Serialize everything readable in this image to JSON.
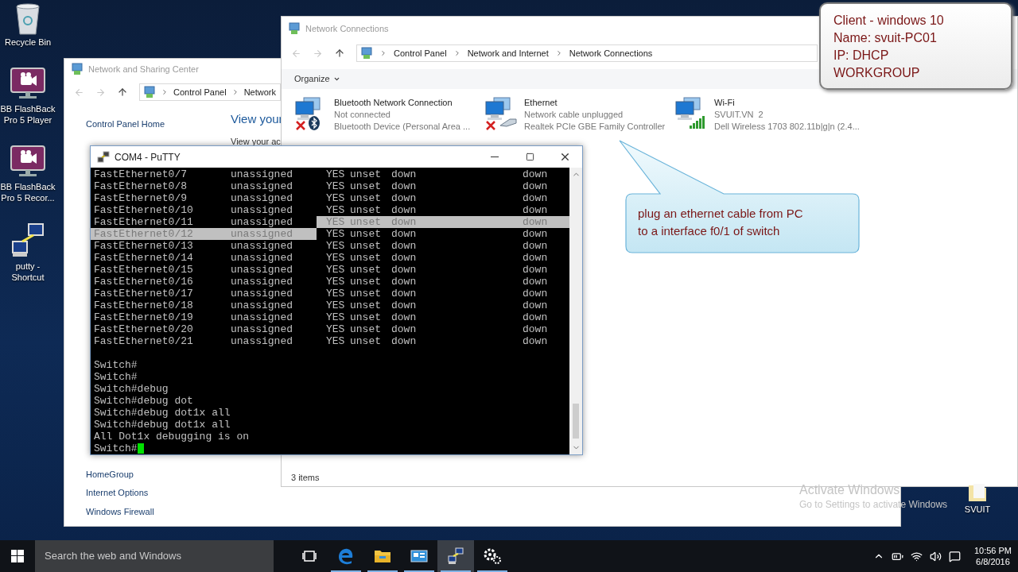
{
  "desktop_icons": [
    {
      "label": "Recycle Bin",
      "kind": "bin"
    },
    {
      "label": "BB FlashBack Pro 5 Player",
      "kind": "flashback"
    },
    {
      "label": "BB FlashBack Pro 5 Recor...",
      "kind": "flashback"
    },
    {
      "label": "putty - Shortcut",
      "kind": "putty"
    }
  ],
  "sharing_center": {
    "title": "Network and Sharing Center",
    "breadcrumb": [
      "Control Panel",
      "Network"
    ],
    "sidebar_link": "Control Panel Home",
    "heading": "View your",
    "subheading": "View your ac",
    "links": [
      "HomeGroup",
      "Internet Options",
      "Windows Firewall"
    ]
  },
  "connections_window": {
    "title": "Network Connections",
    "breadcrumb": [
      "Control Panel",
      "Network and Internet",
      "Network Connections"
    ],
    "toolbar": "Organize",
    "items": [
      {
        "name": "Bluetooth Network Connection",
        "status": "Not connected",
        "device": "Bluetooth Device (Personal Area ...",
        "kind": "bluetooth",
        "disconnected": true
      },
      {
        "name": "Ethernet",
        "status": "Network cable unplugged",
        "device": "Realtek PCIe GBE Family Controller",
        "kind": "ethernet",
        "disconnected": true
      },
      {
        "name": "Wi-Fi",
        "status": "SVUIT.VN  2",
        "device": "Dell Wireless 1703 802.11b|g|n (2.4...",
        "kind": "wifi",
        "disconnected": false
      }
    ],
    "status_bar": "3 items"
  },
  "info_box": [
    "Client - windows 10",
    "Name: svuit-PC01",
    "IP: DHCP",
    "WORKGROUP"
  ],
  "putty": {
    "title": "COM4 - PuTTY",
    "rows": [
      {
        "interface": "FastEthernet0/7",
        "ip": "unassigned",
        "ok": "YES",
        "method": "unset",
        "status": "down",
        "protocol": "down",
        "left_selected": false,
        "right_selected": false
      },
      {
        "interface": "FastEthernet0/8",
        "ip": "unassigned",
        "ok": "YES",
        "method": "unset",
        "status": "down",
        "protocol": "down",
        "left_selected": false,
        "right_selected": false
      },
      {
        "interface": "FastEthernet0/9",
        "ip": "unassigned",
        "ok": "YES",
        "method": "unset",
        "status": "down",
        "protocol": "down",
        "left_selected": false,
        "right_selected": false
      },
      {
        "interface": "FastEthernet0/10",
        "ip": "unassigned",
        "ok": "YES",
        "method": "unset",
        "status": "down",
        "protocol": "down",
        "left_selected": false,
        "right_selected": false
      },
      {
        "interface": "FastEthernet0/11",
        "ip": "unassigned",
        "ok": "YES",
        "method": "unset",
        "status": "down",
        "protocol": "down",
        "left_selected": false,
        "right_selected": true
      },
      {
        "interface": "FastEthernet0/12",
        "ip": "unassigned",
        "ok": "YES",
        "method": "unset",
        "status": "down",
        "protocol": "down",
        "left_selected": true,
        "right_selected": false
      },
      {
        "interface": "FastEthernet0/13",
        "ip": "unassigned",
        "ok": "YES",
        "method": "unset",
        "status": "down",
        "protocol": "down",
        "left_selected": false,
        "right_selected": false
      },
      {
        "interface": "FastEthernet0/14",
        "ip": "unassigned",
        "ok": "YES",
        "method": "unset",
        "status": "down",
        "protocol": "down",
        "left_selected": false,
        "right_selected": false
      },
      {
        "interface": "FastEthernet0/15",
        "ip": "unassigned",
        "ok": "YES",
        "method": "unset",
        "status": "down",
        "protocol": "down",
        "left_selected": false,
        "right_selected": false
      },
      {
        "interface": "FastEthernet0/16",
        "ip": "unassigned",
        "ok": "YES",
        "method": "unset",
        "status": "down",
        "protocol": "down",
        "left_selected": false,
        "right_selected": false
      },
      {
        "interface": "FastEthernet0/17",
        "ip": "unassigned",
        "ok": "YES",
        "method": "unset",
        "status": "down",
        "protocol": "down",
        "left_selected": false,
        "right_selected": false
      },
      {
        "interface": "FastEthernet0/18",
        "ip": "unassigned",
        "ok": "YES",
        "method": "unset",
        "status": "down",
        "protocol": "down",
        "left_selected": false,
        "right_selected": false
      },
      {
        "interface": "FastEthernet0/19",
        "ip": "unassigned",
        "ok": "YES",
        "method": "unset",
        "status": "down",
        "protocol": "down",
        "left_selected": false,
        "right_selected": false
      },
      {
        "interface": "FastEthernet0/20",
        "ip": "unassigned",
        "ok": "YES",
        "method": "unset",
        "status": "down",
        "protocol": "down",
        "left_selected": false,
        "right_selected": false
      },
      {
        "interface": "FastEthernet0/21",
        "ip": "unassigned",
        "ok": "YES",
        "method": "unset",
        "status": "down",
        "protocol": "down",
        "left_selected": false,
        "right_selected": false
      }
    ],
    "lines": [
      "Switch#",
      "Switch#",
      "Switch#debug",
      "Switch#debug dot",
      "Switch#debug dot1x all",
      "Switch#debug dot1x all",
      "All Dot1x debugging is on"
    ],
    "prompt": "Switch#"
  },
  "callout": [
    "plug an ethernet cable from PC",
    "to a interface f0/1 of switch"
  ],
  "activation": {
    "title": "Activate Windows",
    "text": "Go to Settings to activate Windows"
  },
  "desktop_shortcut": "SVUIT",
  "taskbar": {
    "search_placeholder": "Search the web and Windows",
    "apps": [
      {
        "kind": "taskview",
        "running": false,
        "selected": false
      },
      {
        "kind": "edge",
        "running": true,
        "selected": false
      },
      {
        "kind": "explorer",
        "running": true,
        "selected": false
      },
      {
        "kind": "control",
        "running": true,
        "selected": false
      },
      {
        "kind": "putty",
        "running": true,
        "selected": true
      },
      {
        "kind": "gear",
        "running": true,
        "selected": false
      }
    ],
    "time": "10:56 PM",
    "date": "6/8/2016"
  }
}
